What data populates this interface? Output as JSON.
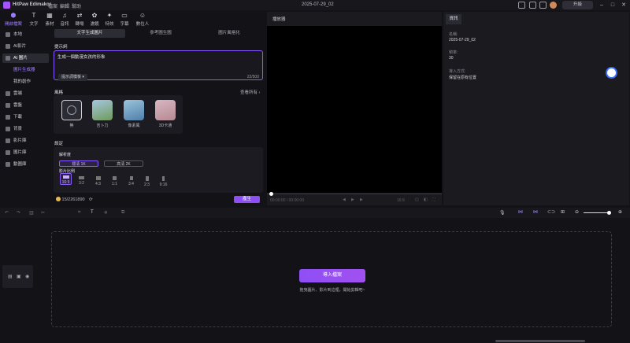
{
  "app": {
    "name": "HitPaw Edimakor",
    "project_title": "2025-07-29_02",
    "upgrade_label": "升級"
  },
  "menu": [
    "檔案",
    "編輯",
    "幫助"
  ],
  "toolbar": [
    "開啟檔案",
    "文字",
    "素材",
    "音訊",
    "轉場",
    "濾鏡",
    "特效",
    "字幕",
    "數位人"
  ],
  "sidebar": {
    "items": [
      "本地",
      "AI影片",
      "AI 圖片"
    ],
    "sub_items": [
      "圖片生成器",
      "我的創作"
    ],
    "more": [
      "雲端",
      "雲盤",
      "下載",
      "背景",
      "影片庫",
      "圖片庫",
      "動圖庫"
    ]
  },
  "center": {
    "tabs": [
      "文字生成圖片",
      "參考圖生圖",
      "圖片風格化"
    ],
    "prompt_label": "提示詞",
    "prompt_value": "生成一個動漫女孩的形象",
    "template_button": "提示詞模板",
    "char_count": "22/500",
    "style_label": "風格",
    "view_all": "查看所有",
    "styles": [
      {
        "name": "無",
        "color": "#2b2b33"
      },
      {
        "name": "吉卜力",
        "color": "#6f9a5a"
      },
      {
        "name": "像素風",
        "color": "#4f7fa8"
      },
      {
        "name": "3D卡通",
        "color": "#b58a92"
      }
    ],
    "settings_label": "設定",
    "resolution_label": "解析度",
    "resolutions": [
      "標清 1K",
      "高清 2K"
    ],
    "aspect_label": "影片比例",
    "ratios": [
      "16:9",
      "3:2",
      "4:3",
      "1:1",
      "3:4",
      "2:3",
      "9:16"
    ],
    "credits": "15/2261890",
    "generate_label": "產生"
  },
  "player": {
    "title": "播放器",
    "time": "00:00:00 / 00:00:00",
    "speed": "16:9"
  },
  "info": {
    "tab": "資訊",
    "fields": [
      {
        "key": "名稱:",
        "value": "2025-07-29_02"
      },
      {
        "key": "幀率:",
        "value": "30"
      },
      {
        "key": "導入方式:",
        "value": "保留在原有位置"
      }
    ]
  },
  "timeline": {
    "import_button": "導入檔案",
    "hint": "拖曳圖片、影片到這裡，開始剪輯吧~"
  },
  "colors": {
    "accent": "#8a5cff",
    "generate": "#8d4ef5"
  }
}
